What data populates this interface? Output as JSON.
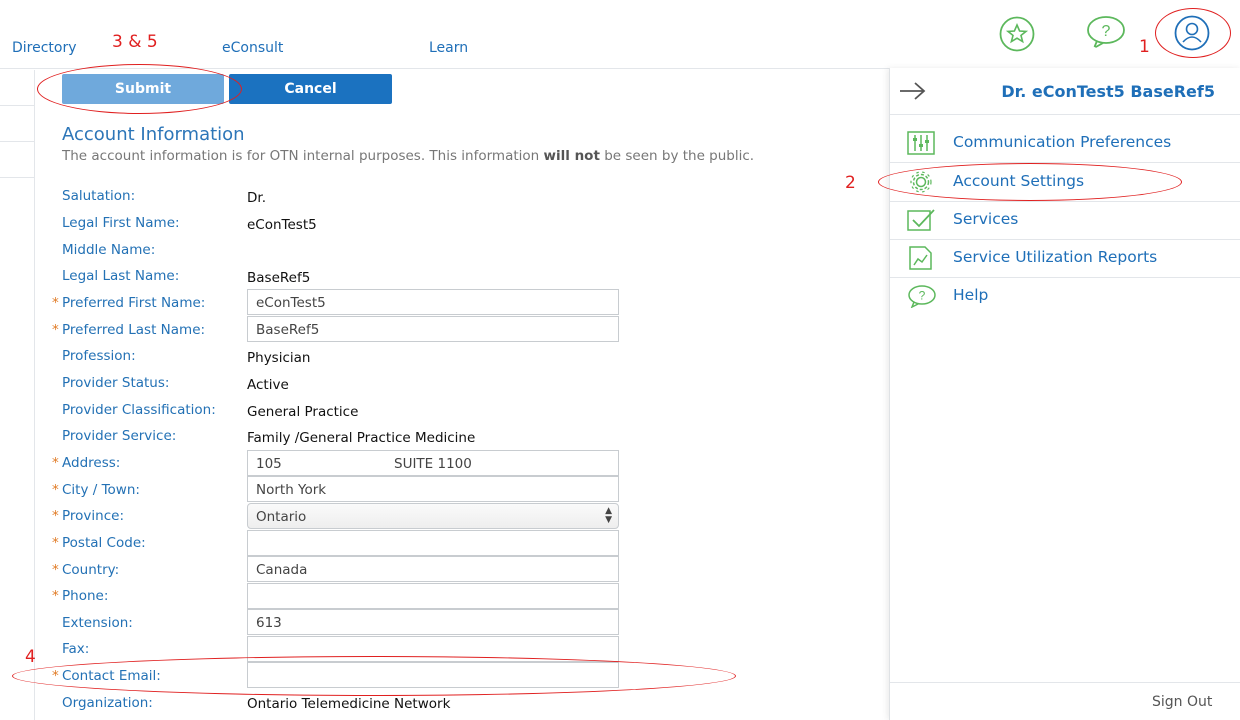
{
  "topnav": {
    "directory": "Directory",
    "econsult": "eConsult",
    "learn": "Learn"
  },
  "top_icons": [
    "star-icon",
    "help-chat-icon",
    "user-profile-icon"
  ],
  "buttons": {
    "submit": "Submit",
    "cancel": "Cancel"
  },
  "account": {
    "title": "Account Information",
    "desc_before": "The account information is for OTN internal purposes. This information ",
    "desc_bold": "will not",
    "desc_after": " be seen by the public."
  },
  "form": {
    "salutation": {
      "label": "Salutation:",
      "value": "Dr."
    },
    "legal_first": {
      "label": "Legal First Name:",
      "value": "eConTest5"
    },
    "middle": {
      "label": "Middle Name:",
      "value": ""
    },
    "legal_last": {
      "label": "Legal Last Name:",
      "value": "BaseRef5"
    },
    "pref_first": {
      "label": "Preferred First Name:",
      "value": "eConTest5"
    },
    "pref_last": {
      "label": "Preferred Last Name:",
      "value": "BaseRef5"
    },
    "profession": {
      "label": "Profession:",
      "value": "Physician"
    },
    "status": {
      "label": "Provider Status:",
      "value": "Active"
    },
    "classification": {
      "label": "Provider Classification:",
      "value": "General Practice"
    },
    "service": {
      "label": "Provider Service:",
      "value": "Family /General Practice Medicine"
    },
    "address": {
      "label": "Address:",
      "value": "105",
      "value2": "SUITE 1100"
    },
    "city": {
      "label": "City / Town:",
      "value": "North York"
    },
    "province": {
      "label": "Province:",
      "value": "Ontario"
    },
    "postal": {
      "label": "Postal Code:",
      "value": ""
    },
    "country": {
      "label": "Country:",
      "value": "Canada"
    },
    "phone": {
      "label": "Phone:",
      "value": ""
    },
    "extension": {
      "label": "Extension:",
      "value": "613"
    },
    "fax": {
      "label": "Fax:",
      "value": ""
    },
    "email": {
      "label": "Contact Email:",
      "value": ""
    },
    "organization": {
      "label": "Organization:",
      "value": "Ontario Telemedicine Network"
    },
    "required_mark": "*"
  },
  "panel": {
    "name": "Dr. eConTest5 BaseRef5",
    "items": [
      {
        "label": "Communication Preferences",
        "icon": "sliders-icon"
      },
      {
        "label": "Account Settings",
        "icon": "gear-icon"
      },
      {
        "label": "Services",
        "icon": "checkbox-icon"
      },
      {
        "label": "Service Utilization Reports",
        "icon": "report-chart-icon"
      },
      {
        "label": "Help",
        "icon": "help-chat-icon"
      }
    ],
    "sign_out": "Sign Out"
  },
  "annotations": {
    "a1": "1",
    "a2": "2",
    "a35": "3 & 5",
    "a4": "4"
  },
  "colors": {
    "accent": "#1f6fb8",
    "submit": "#6fa9dc",
    "cancel": "#1b72c0",
    "green_icon": "#5cb85c",
    "annotation": "#e02020",
    "required": "#e07a24"
  }
}
